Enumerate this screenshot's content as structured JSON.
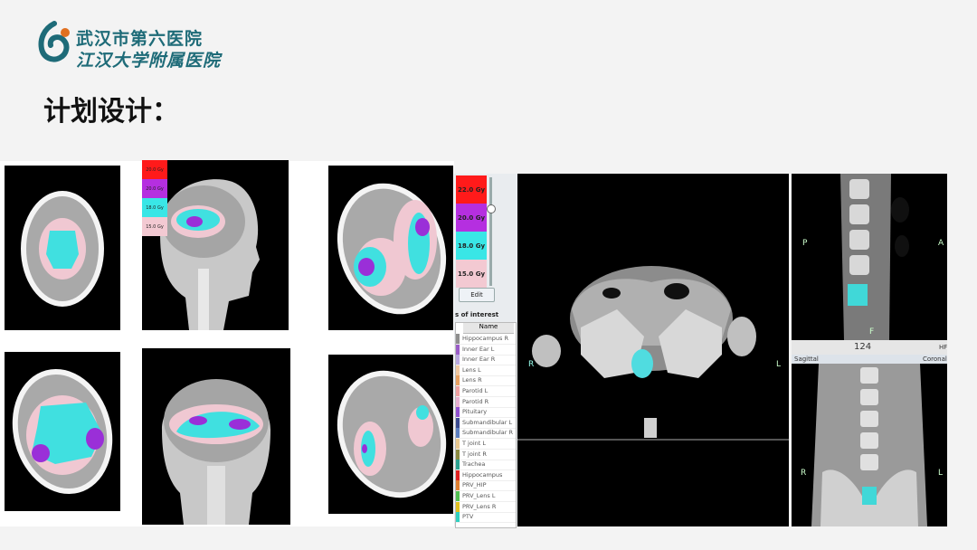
{
  "header": {
    "logo_icon": "hospital-logo-icon",
    "hospital_name": "武汉市第六医院",
    "affiliation": "江汉大学附属医院",
    "title": "计划设计："
  },
  "dose_legend_small": [
    {
      "label": "20.0 Gy",
      "color": "#ff1a1a"
    },
    {
      "label": "20.0 Gy",
      "color": "#b52fe0"
    },
    {
      "label": "18.0 Gy",
      "color": "#39e6e6"
    },
    {
      "label": "15.0 Gy",
      "color": "#f3c9d2"
    }
  ],
  "dose_legend_large": [
    {
      "label": "22.0 Gy",
      "color": "#ff1a1a"
    },
    {
      "label": "20.0 Gy",
      "color": "#b52fe0"
    },
    {
      "label": "18.0 Gy",
      "color": "#39e6e6"
    },
    {
      "label": "15.0 Gy",
      "color": "#f3c9d2"
    }
  ],
  "edit_button": "Edit",
  "roi_header": "s of interest",
  "roi_column": "Name",
  "roi_list": [
    {
      "name": "Hippocampus R",
      "color": "#8e8e8e"
    },
    {
      "name": "Inner Ear L",
      "color": "#9a5cc8"
    },
    {
      "name": "Inner Ear R",
      "color": "#b9a8e0"
    },
    {
      "name": "Lens L",
      "color": "#f0c8a0"
    },
    {
      "name": "Lens R",
      "color": "#e8a060"
    },
    {
      "name": "Parotid L",
      "color": "#f0a0a0"
    },
    {
      "name": "Parotid R",
      "color": "#e8b0d0"
    },
    {
      "name": "Pituitary",
      "color": "#9050d0"
    },
    {
      "name": "Submandibular L",
      "color": "#3a4a90"
    },
    {
      "name": "Submandibular R",
      "color": "#5b7ec0"
    },
    {
      "name": "T joint L",
      "color": "#e8c890"
    },
    {
      "name": "T joint R",
      "color": "#8a8a40"
    },
    {
      "name": "Trachea",
      "color": "#2aa090"
    },
    {
      "name": "Hippocampus",
      "color": "#e02020"
    },
    {
      "name": "PRV_HIP",
      "color": "#e08030"
    },
    {
      "name": "PRV_Lens L",
      "color": "#50c050"
    },
    {
      "name": "PRV_Lens R",
      "color": "#e0c020"
    },
    {
      "name": "PTV",
      "color": "#30d0c0"
    }
  ],
  "viewer": {
    "axial_right_label": "R",
    "axial_left_label": "L",
    "sag_p": "P",
    "sag_a": "A",
    "sag_f": "F",
    "sag_hf": "HF",
    "slice_number": "124",
    "sagittal_tab": "Sagittal",
    "coronal_tab": "Coronal",
    "cor_r": "R",
    "cor_l": "L"
  }
}
